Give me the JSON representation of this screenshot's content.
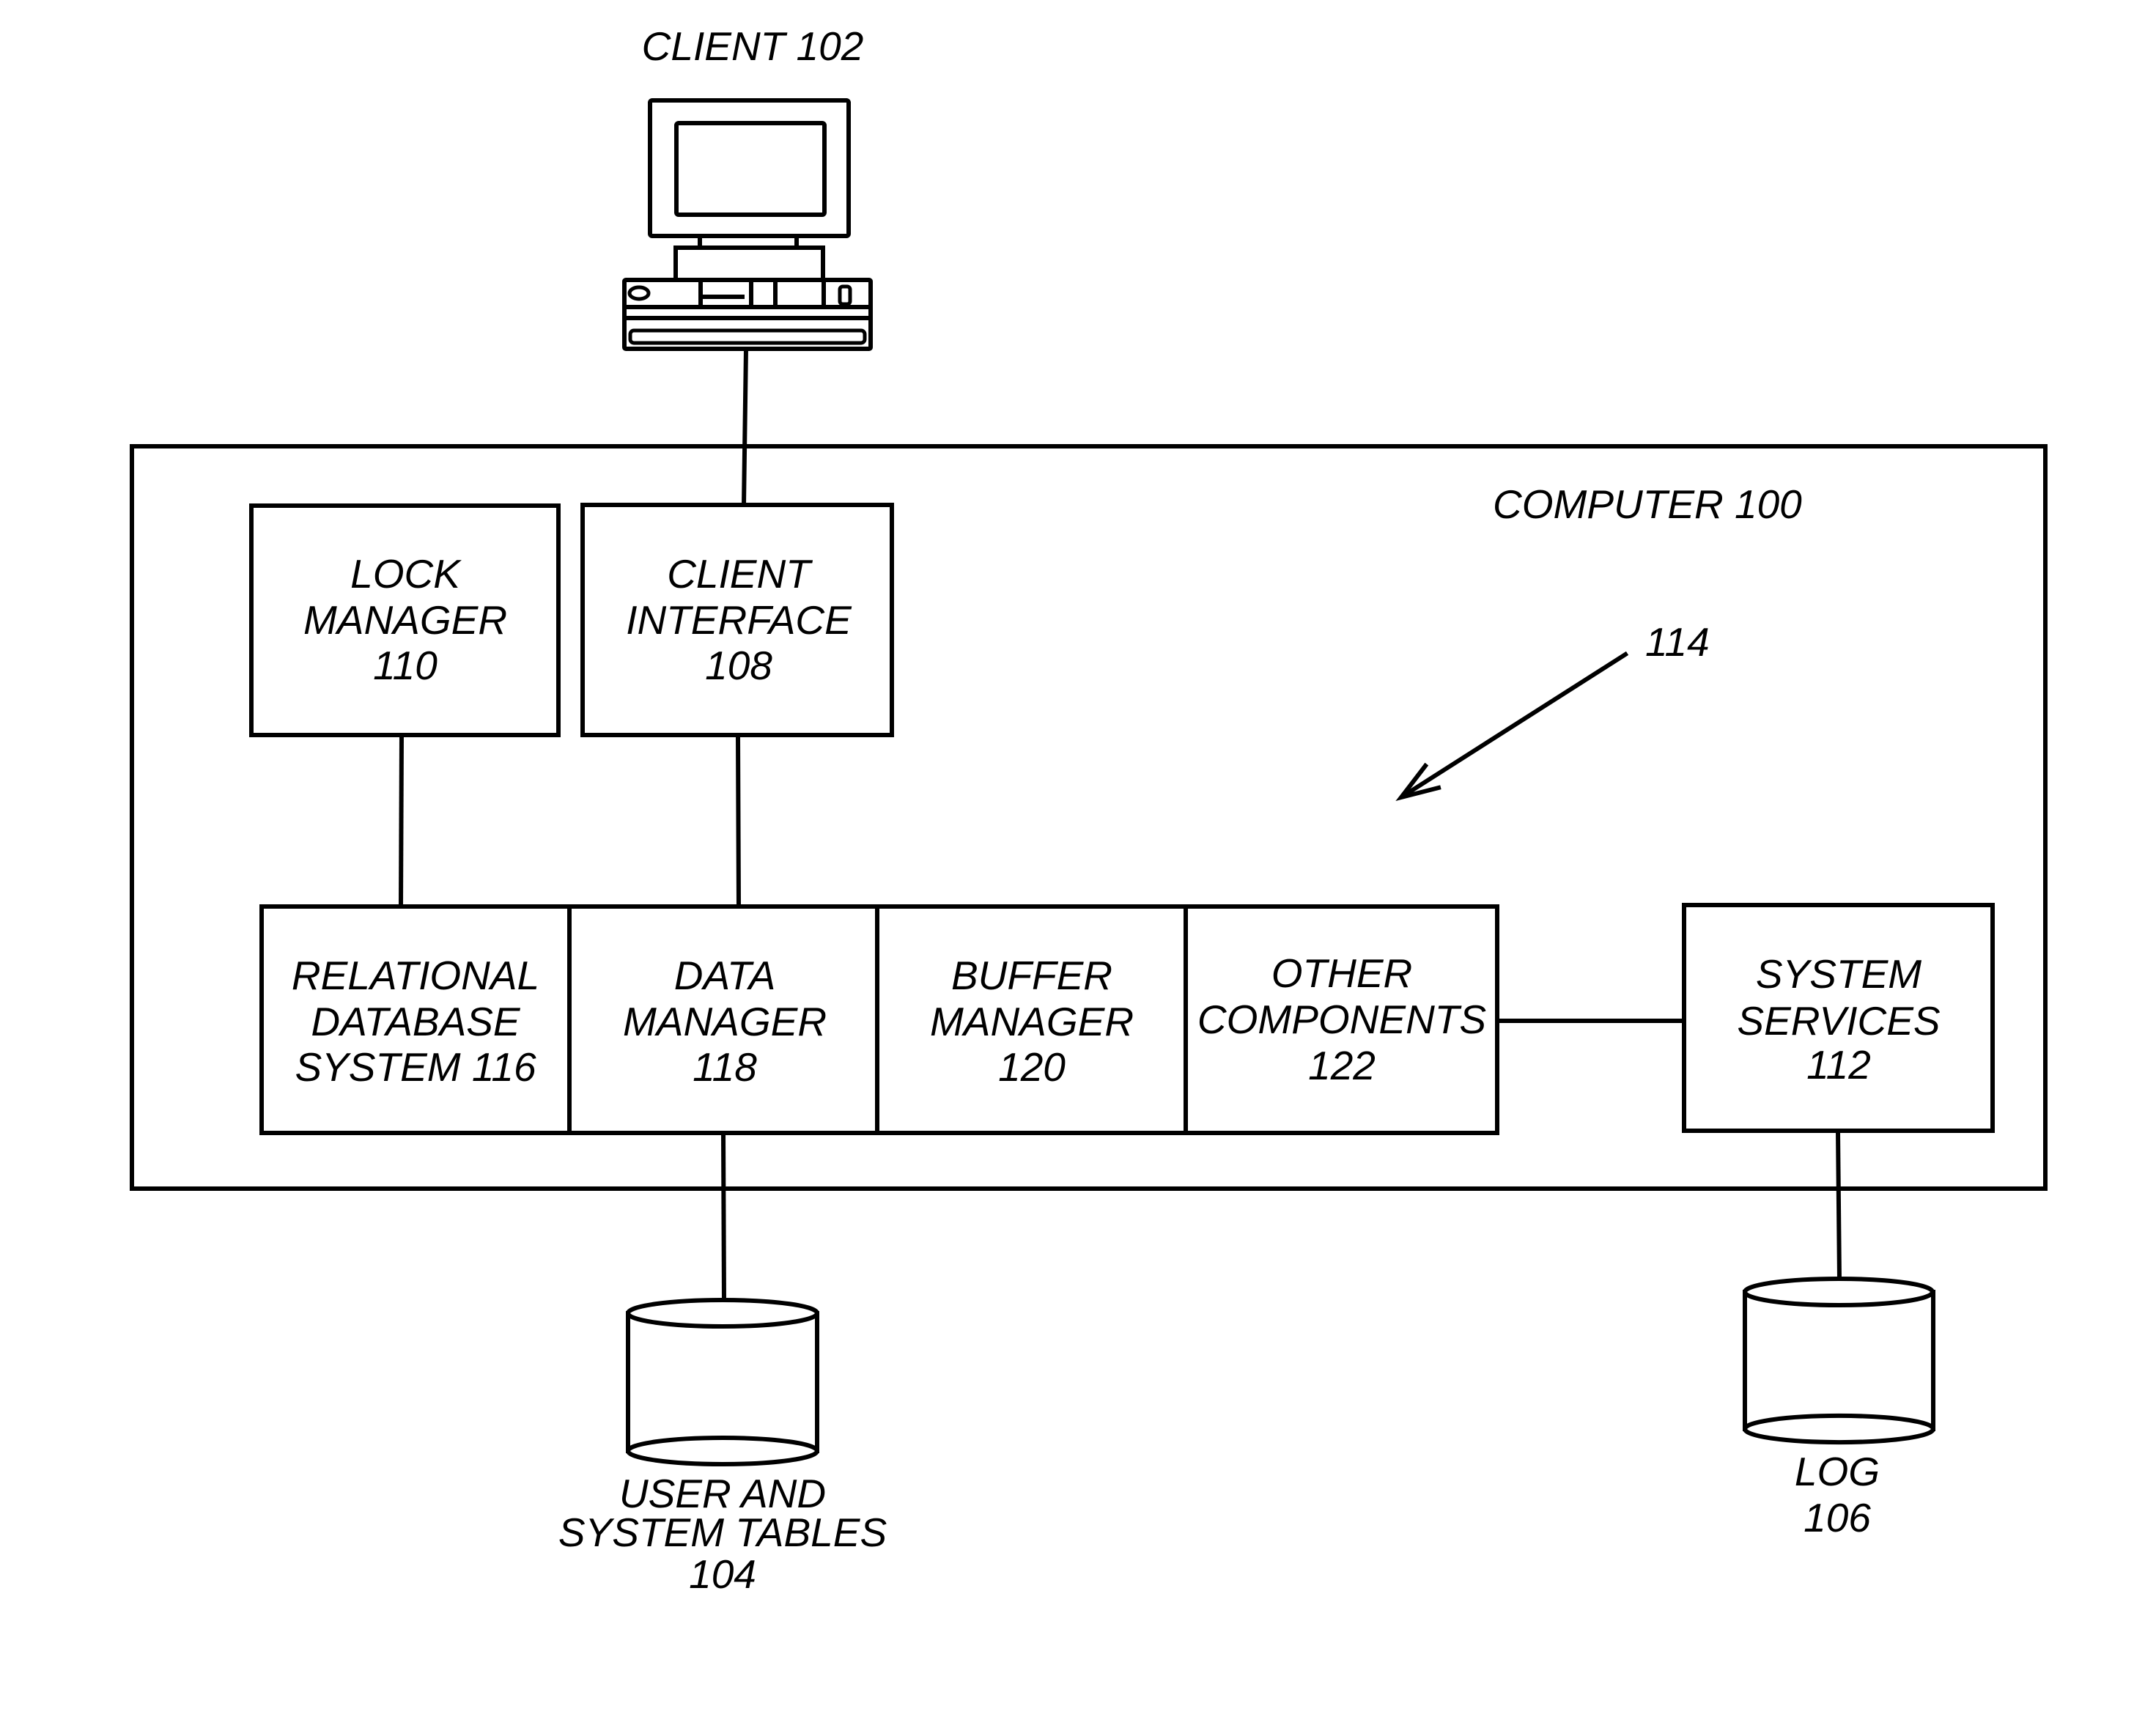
{
  "diagram": {
    "client": {
      "title": "CLIENT 102",
      "icon": "desktop-computer-icon"
    },
    "computer": {
      "title": "COMPUTER 100"
    },
    "reference_arrow": {
      "label": "114"
    },
    "lock_manager": {
      "lines": [
        "LOCK",
        "MANAGER",
        "110"
      ]
    },
    "client_interface": {
      "lines": [
        "CLIENT",
        "INTERFACE",
        "108"
      ]
    },
    "rdbms_row": [
      {
        "lines": [
          "RELATIONAL",
          "DATABASE",
          "SYSTEM 116"
        ]
      },
      {
        "lines": [
          "DATA",
          "MANAGER",
          "118"
        ]
      },
      {
        "lines": [
          "BUFFER",
          "MANAGER",
          "120"
        ]
      },
      {
        "lines": [
          "OTHER",
          "COMPONENTS",
          "122"
        ]
      }
    ],
    "system_services": {
      "lines": [
        "SYSTEM",
        "SERVICES",
        "112"
      ]
    },
    "user_tables": {
      "lines": [
        "USER AND",
        "SYSTEM TABLES",
        "104"
      ],
      "icon": "database-cylinder-icon"
    },
    "log": {
      "lines": [
        "LOG",
        "106"
      ],
      "icon": "database-cylinder-icon"
    },
    "colors": {
      "stroke": "#000000",
      "background": "#ffffff"
    }
  }
}
